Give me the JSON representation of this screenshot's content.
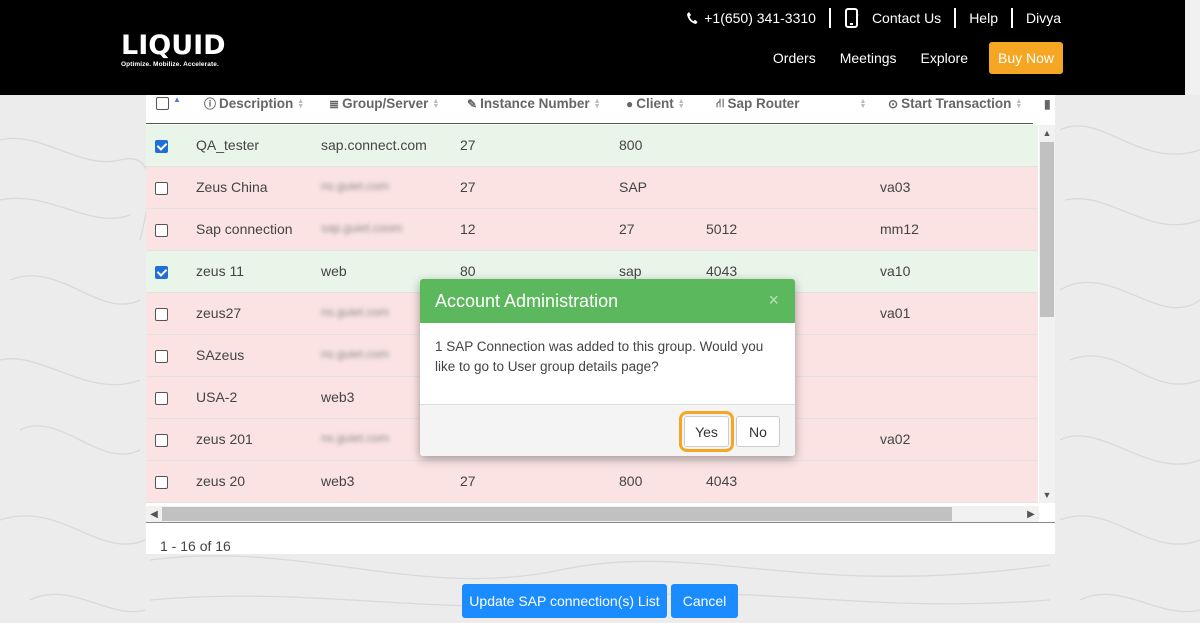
{
  "brand": {
    "logo_text": "LIQUID",
    "tagline": "Optimize. Mobilize. Accelerate.",
    "accent_color": "#f5a623"
  },
  "topbar": {
    "phone": "+1(650) 341-3310",
    "contact": "Contact Us",
    "help": "Help",
    "user": "Divya"
  },
  "nav": {
    "orders": "Orders",
    "meetings": "Meetings",
    "explore": "Explore",
    "buy_now": "Buy Now"
  },
  "table": {
    "columns": [
      "Description",
      "Group/Server",
      "Instance Number",
      "Client",
      "Sap Router",
      "Start Transaction"
    ],
    "rows": [
      {
        "checked": true,
        "status": "green",
        "description": "QA_tester",
        "server": "sap.connect.com",
        "server_blurred": false,
        "instance": "27",
        "client": "800",
        "router": "",
        "transaction": ""
      },
      {
        "checked": false,
        "status": "red",
        "description": "Zeus China",
        "server": "ns.guiet.com",
        "server_blurred": true,
        "instance": "27",
        "client": "SAP",
        "router": "",
        "transaction": "va03"
      },
      {
        "checked": false,
        "status": "red",
        "description": "Sap connection",
        "server": "sap.guiet.coom",
        "server_blurred": true,
        "instance": "12",
        "client": "27",
        "router": "5012",
        "transaction": "mm12"
      },
      {
        "checked": true,
        "status": "green",
        "description": "zeus 11",
        "server": "web",
        "server_blurred": false,
        "instance": "80",
        "client": "sap",
        "router": "4043",
        "transaction": "va10"
      },
      {
        "checked": false,
        "status": "red",
        "description": "zeus27",
        "server": "ns.guiet.com",
        "server_blurred": true,
        "instance": "",
        "client": "",
        "router": "",
        "transaction": "va01"
      },
      {
        "checked": false,
        "status": "red",
        "description": "SAzeus",
        "server": "ns.guiet.com",
        "server_blurred": true,
        "instance": "",
        "client": "",
        "router": "",
        "transaction": ""
      },
      {
        "checked": false,
        "status": "red",
        "description": "USA-2",
        "server": "web3",
        "server_blurred": false,
        "instance": "",
        "client": "",
        "router": "",
        "transaction": ""
      },
      {
        "checked": false,
        "status": "red",
        "description": "zeus 201",
        "server": "ns.guiet.com",
        "server_blurred": true,
        "instance": "",
        "client": "",
        "router": "",
        "transaction": "va02"
      },
      {
        "checked": false,
        "status": "red",
        "description": "zeus 20",
        "server": "web3",
        "server_blurred": false,
        "instance": "27",
        "client": "800",
        "router": "4043",
        "transaction": ""
      }
    ],
    "pager": "1 - 16 of 16",
    "row_green": "#eaf5ea",
    "row_red": "#fbe3e3"
  },
  "actions": {
    "update": "Update SAP connection(s) List",
    "cancel": "Cancel"
  },
  "modal": {
    "title": "Account Administration",
    "close": "×",
    "message": "1 SAP Connection was added to this group. Would you like to go to User group details page?",
    "yes": "Yes",
    "no": "No",
    "header_color": "#5cb85c"
  }
}
